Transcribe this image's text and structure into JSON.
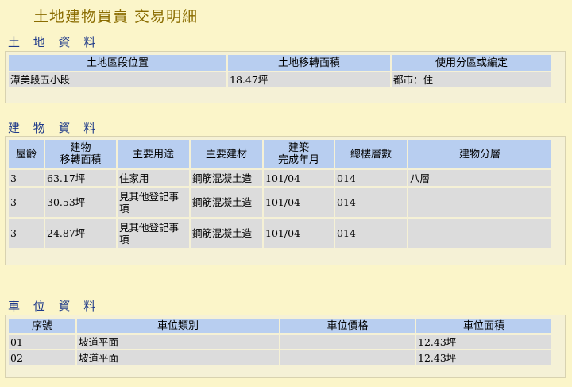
{
  "page_title": "土地建物買賣 交易明細",
  "land": {
    "title": "土 地 資 料",
    "headers": [
      "土地區段位置",
      "土地移轉面積",
      "使用分區或編定"
    ],
    "rows": [
      [
        "潭美段五小段",
        "18.47坪",
        "都市：住"
      ]
    ]
  },
  "building": {
    "title": "建 物 資 料",
    "headers": [
      "屋齡",
      "建物移轉面積",
      "主要用途",
      "主要建材",
      "建築完成年月",
      "總樓層數",
      "建物分層"
    ],
    "headers_line1": [
      "屋齡",
      "建物",
      "主要用途",
      "主要建材",
      "建築",
      "總樓層數",
      "建物分層"
    ],
    "headers_line2": [
      "",
      "移轉面積",
      "",
      "",
      "完成年月",
      "",
      ""
    ],
    "rows": [
      [
        "3",
        "63.17坪",
        "住家用",
        "鋼筋混凝土造",
        "101/04",
        "014",
        "八層"
      ],
      [
        "3",
        "30.53坪",
        "見其他登記事項",
        "鋼筋混凝土造",
        "101/04",
        "014",
        ""
      ],
      [
        "3",
        "24.87坪",
        "見其他登記事項",
        "鋼筋混凝土造",
        "101/04",
        "014",
        ""
      ]
    ],
    "usage_wrap": [
      [
        "住家用",
        ""
      ],
      [
        "見其他登記事",
        "項"
      ],
      [
        "見其他登記事",
        "項"
      ]
    ]
  },
  "parking": {
    "title": "車 位 資 料",
    "headers": [
      "序號",
      "車位類別",
      "車位價格",
      "車位面積"
    ],
    "rows": [
      [
        "01",
        "坡道平面",
        "",
        "12.43坪"
      ],
      [
        "02",
        "坡道平面",
        "",
        "12.43坪"
      ]
    ]
  }
}
